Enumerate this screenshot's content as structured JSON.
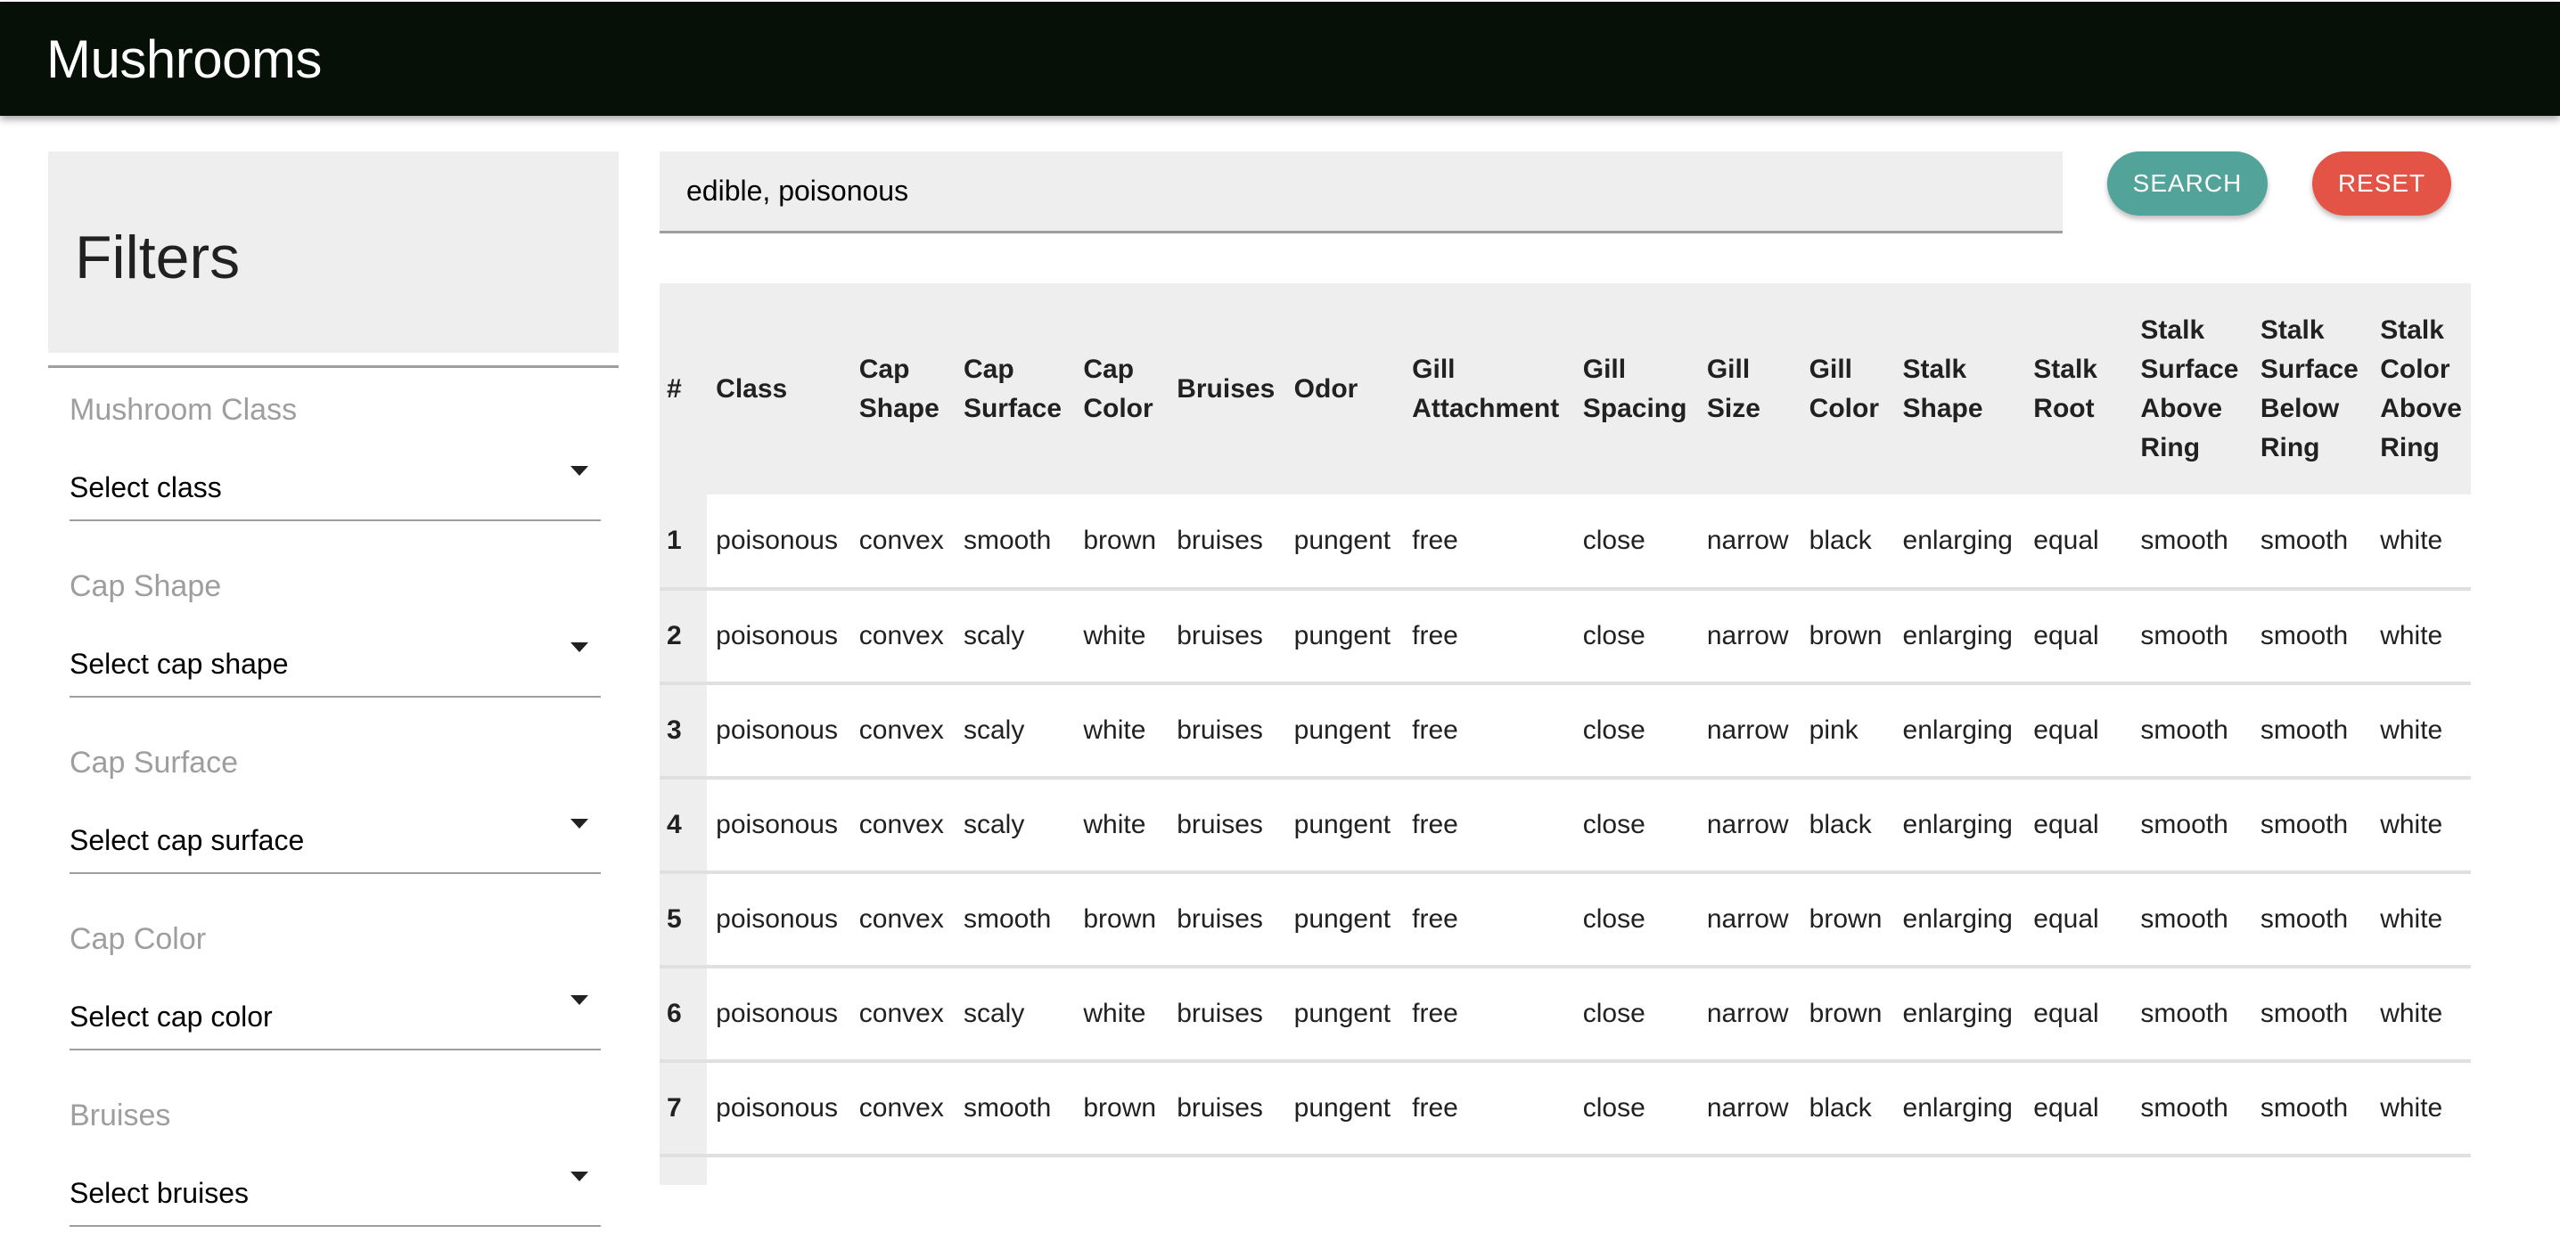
{
  "app": {
    "title": "Mushrooms"
  },
  "sidebar": {
    "title": "Filters",
    "filters": [
      {
        "label": "Mushroom Class",
        "value": "Select class"
      },
      {
        "label": "Cap Shape",
        "value": "Select cap shape"
      },
      {
        "label": "Cap Surface",
        "value": "Select cap surface"
      },
      {
        "label": "Cap Color",
        "value": "Select cap color"
      },
      {
        "label": "Bruises",
        "value": "Select bruises"
      }
    ]
  },
  "search": {
    "value": "edible, poisonous",
    "search_label": "SEARCH",
    "reset_label": "RESET"
  },
  "colors": {
    "appbar": "#061006",
    "search_button": "#52a39a",
    "reset_button": "#e35446",
    "panel": "#eeeeee"
  },
  "table": {
    "columns": [
      "#",
      "Class",
      "Cap Shape",
      "Cap Surface",
      "Cap Color",
      "Bruises",
      "Odor",
      "Gill Attachment",
      "Gill Spacing",
      "Gill Size",
      "Gill Color",
      "Stalk Shape",
      "Stalk Root",
      "Stalk Surface Above Ring",
      "Stalk Surface Below Ring",
      "Stalk Color Above Ring"
    ],
    "rows": [
      [
        "1",
        "poisonous",
        "convex",
        "smooth",
        "brown",
        "bruises",
        "pungent",
        "free",
        "close",
        "narrow",
        "black",
        "enlarging",
        "equal",
        "smooth",
        "smooth",
        "white"
      ],
      [
        "2",
        "poisonous",
        "convex",
        "scaly",
        "white",
        "bruises",
        "pungent",
        "free",
        "close",
        "narrow",
        "brown",
        "enlarging",
        "equal",
        "smooth",
        "smooth",
        "white"
      ],
      [
        "3",
        "poisonous",
        "convex",
        "scaly",
        "white",
        "bruises",
        "pungent",
        "free",
        "close",
        "narrow",
        "pink",
        "enlarging",
        "equal",
        "smooth",
        "smooth",
        "white"
      ],
      [
        "4",
        "poisonous",
        "convex",
        "scaly",
        "white",
        "bruises",
        "pungent",
        "free",
        "close",
        "narrow",
        "black",
        "enlarging",
        "equal",
        "smooth",
        "smooth",
        "white"
      ],
      [
        "5",
        "poisonous",
        "convex",
        "smooth",
        "brown",
        "bruises",
        "pungent",
        "free",
        "close",
        "narrow",
        "brown",
        "enlarging",
        "equal",
        "smooth",
        "smooth",
        "white"
      ],
      [
        "6",
        "poisonous",
        "convex",
        "scaly",
        "white",
        "bruises",
        "pungent",
        "free",
        "close",
        "narrow",
        "brown",
        "enlarging",
        "equal",
        "smooth",
        "smooth",
        "white"
      ],
      [
        "7",
        "poisonous",
        "convex",
        "smooth",
        "brown",
        "bruises",
        "pungent",
        "free",
        "close",
        "narrow",
        "black",
        "enlarging",
        "equal",
        "smooth",
        "smooth",
        "white"
      ],
      [
        "",
        "",
        "",
        "",
        "",
        "",
        "",
        "",
        "",
        "",
        "",
        "",
        "",
        "",
        "",
        ""
      ]
    ]
  }
}
